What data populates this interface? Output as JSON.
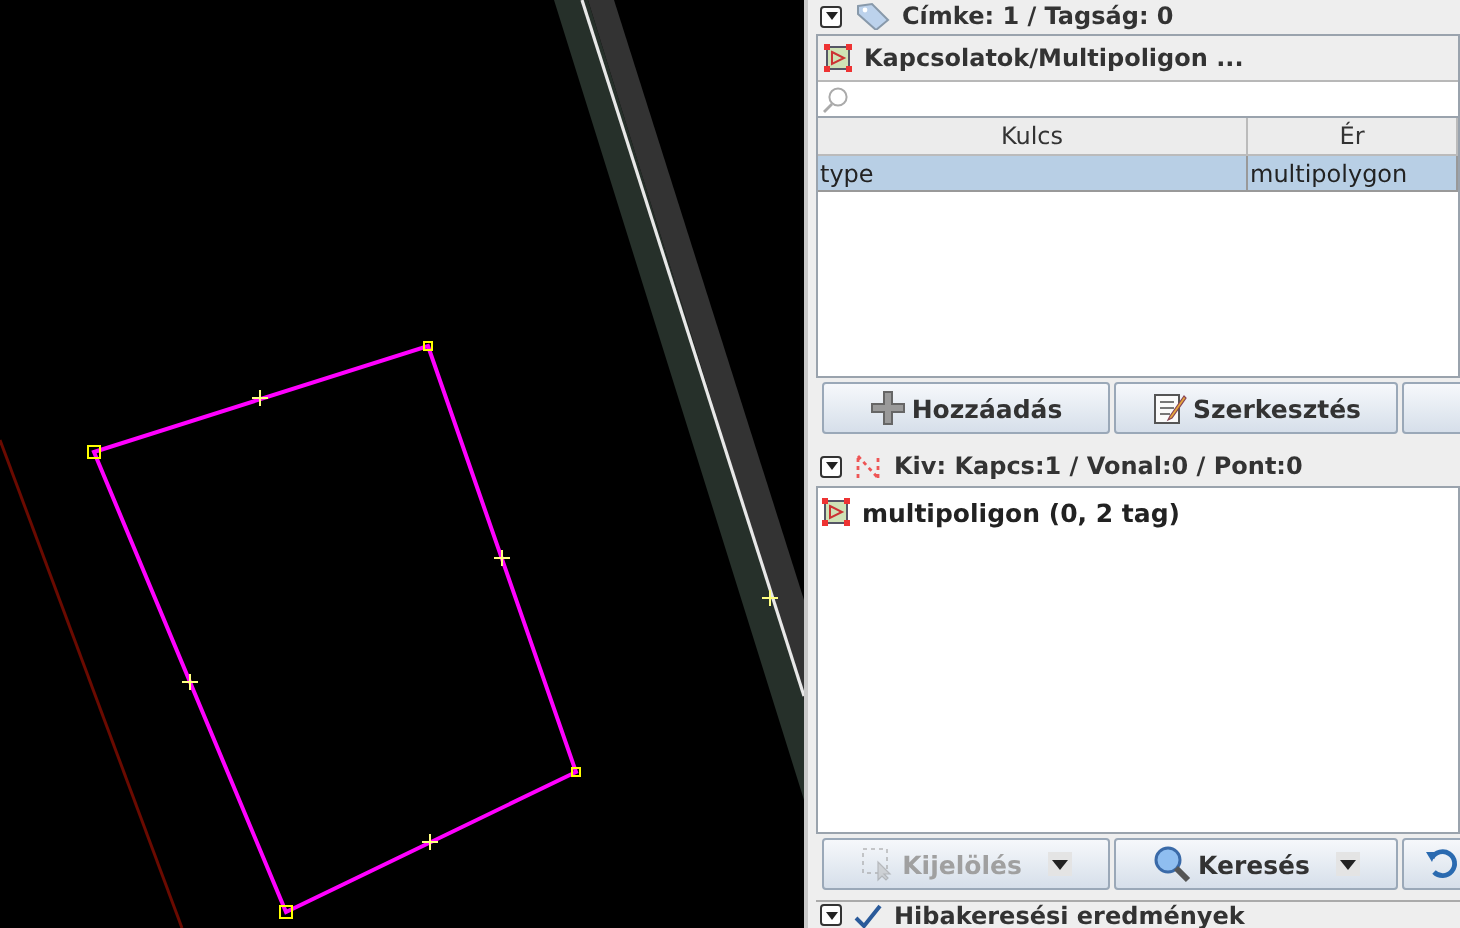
{
  "tags_panel": {
    "title": "Címke: 1 / Tagság: 0",
    "expanded": true,
    "relation_title": "Kapcsolatok/Multipoligon ...",
    "table": {
      "columns": [
        "Kulcs",
        "Ér"
      ],
      "rows": [
        {
          "key": "type",
          "value": "multipolygon",
          "selected": true
        }
      ]
    },
    "buttons": [
      {
        "kind": "add",
        "label": "Hozzáadás"
      },
      {
        "kind": "edit",
        "label": "Szerkesztés"
      },
      {
        "kind": "blank"
      }
    ]
  },
  "selection_panel": {
    "title": "Kiv: Kapcs:1 / Vonal:0 / Pont:0",
    "expanded": true,
    "items": [
      {
        "label": "multipoligon (0, 2 tag)",
        "selected": false
      }
    ],
    "buttons": [
      {
        "kind": "select",
        "label": "Kijelölés",
        "disabled": true,
        "dropdown": true
      },
      {
        "kind": "search",
        "label": "Keresés",
        "disabled": false,
        "dropdown": true
      },
      {
        "kind": "history",
        "disabled": false,
        "dropdown": false
      }
    ]
  },
  "validation_panel": {
    "title": "Hibakeresési eredmények",
    "expanded": true
  }
}
